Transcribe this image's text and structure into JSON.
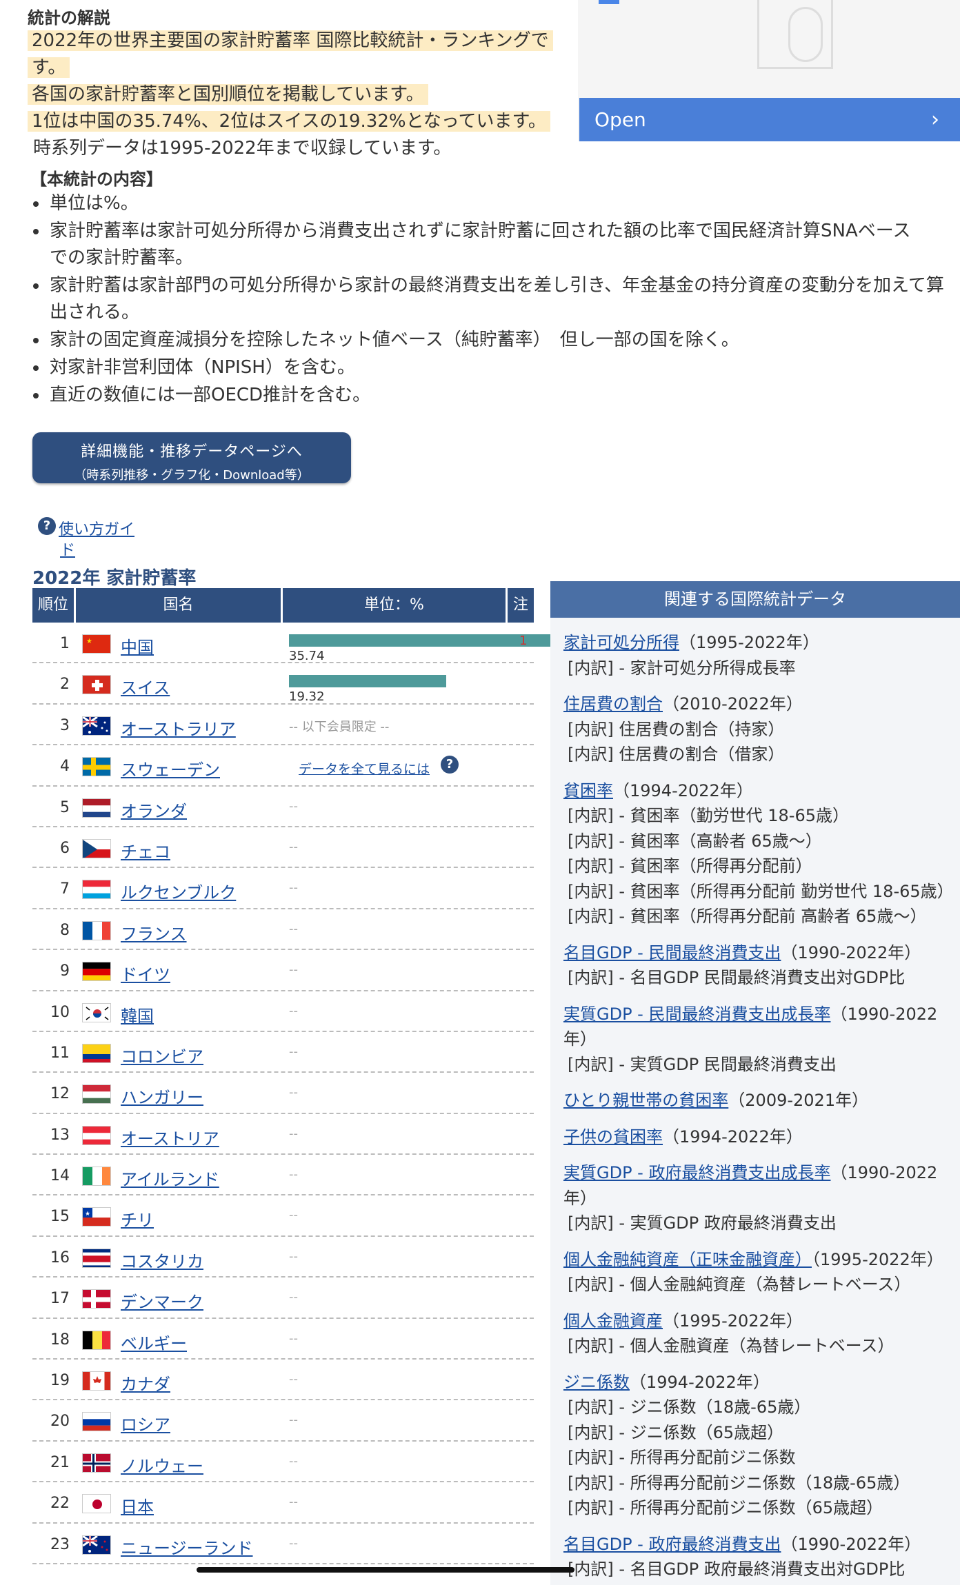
{
  "section_title": "統計の解説",
  "description": {
    "highlight_lines": [
      "2022年の世界主要国の家計貯蓄率 国際比較統計・ランキングで",
      "す。",
      "各国の家計貯蓄率と国別順位を掲載しています。",
      "1位は中国の35.74%、2位はスイスの19.32%となっています。"
    ],
    "plain_line": "時系列データは1995-2022年まで収録しています。"
  },
  "content_heading": "【本統計の内容】",
  "bullets": [
    "単位は%。",
    "家計貯蓄率は家計可処分所得から消費支出されずに家計貯蓄に回された額の比率で国民経済計算SNAベースでの家計貯蓄率。",
    "家計貯蓄は家計部門の可処分所得から家計の最終消費支出を差し引き、年金基金の持分資産の変動分を加えて算出される。",
    "家計の固定資産減損分を控除したネット値ベース（純貯蓄率）　但し一部の国を除く。",
    "対家計非営利団体（NPISH）を含む。",
    "直近の数値には一部OECD推計を含む。"
  ],
  "detail_button": {
    "line1": "詳細機能・推移データページへ",
    "line2": "（時系列推移・グラフ化・Download等）"
  },
  "ad": {
    "open_label": "Open",
    "chevron": "›"
  },
  "guide": {
    "line1": "使い方ガイ",
    "line2": "ド",
    "icon": "?"
  },
  "table": {
    "title": "2022年 家計貯蓄率",
    "headers": {
      "rank": "順位",
      "country": "国名",
      "unit": "単位：%",
      "note": "注"
    },
    "members_only": "-- 以下会員限定 --",
    "see_all": "データを全て見るには",
    "dash": "--",
    "rows": [
      {
        "rank": "1",
        "name": "中国",
        "value": "35.74",
        "bar_fraction": 1.0,
        "note": "1",
        "flag": "cn"
      },
      {
        "rank": "2",
        "name": "スイス",
        "value": "19.32",
        "bar_fraction": 0.5406,
        "flag": "ch"
      },
      {
        "rank": "3",
        "name": "オーストラリア",
        "flag": "au"
      },
      {
        "rank": "4",
        "name": "スウェーデン",
        "flag": "se"
      },
      {
        "rank": "5",
        "name": "オランダ",
        "flag": "nl"
      },
      {
        "rank": "6",
        "name": "チェコ",
        "flag": "cz"
      },
      {
        "rank": "7",
        "name": "ルクセンブルク",
        "flag": "lu"
      },
      {
        "rank": "8",
        "name": "フランス",
        "flag": "fr"
      },
      {
        "rank": "9",
        "name": "ドイツ",
        "flag": "de"
      },
      {
        "rank": "10",
        "name": "韓国",
        "flag": "kr"
      },
      {
        "rank": "11",
        "name": "コロンビア",
        "flag": "co"
      },
      {
        "rank": "12",
        "name": "ハンガリー",
        "flag": "hu"
      },
      {
        "rank": "13",
        "name": "オーストリア",
        "flag": "at"
      },
      {
        "rank": "14",
        "name": "アイルランド",
        "flag": "ie"
      },
      {
        "rank": "15",
        "name": "チリ",
        "flag": "cl"
      },
      {
        "rank": "16",
        "name": "コスタリカ",
        "flag": "cr"
      },
      {
        "rank": "17",
        "name": "デンマーク",
        "flag": "dk"
      },
      {
        "rank": "18",
        "name": "ベルギー",
        "flag": "be"
      },
      {
        "rank": "19",
        "name": "カナダ",
        "flag": "ca"
      },
      {
        "rank": "20",
        "name": "ロシア",
        "flag": "ru"
      },
      {
        "rank": "21",
        "name": "ノルウェー",
        "flag": "no"
      },
      {
        "rank": "22",
        "name": "日本",
        "flag": "jp"
      },
      {
        "rank": "23",
        "name": "ニュージーランド",
        "flag": "nz"
      }
    ]
  },
  "sidebar": {
    "title": "関連する国際統計データ",
    "items": [
      {
        "link": "家計可処分所得",
        "period": "（1995-2022年）",
        "subs": [
          "[内訳] - 家計可処分所得成長率"
        ]
      },
      {
        "link": "住居費の割合",
        "period": "（2010-2022年）",
        "subs": [
          "[内訳] 住居費の割合（持家）",
          "[内訳] 住居費の割合（借家）"
        ]
      },
      {
        "link": "貧困率",
        "period": "（1994-2022年）",
        "subs": [
          "[内訳] - 貧困率（勤労世代 18-65歳）",
          "[内訳] - 貧困率（高齢者 65歳～）",
          "[内訳] - 貧困率（所得再分配前）",
          "[内訳] - 貧困率（所得再分配前 勤労世代 18-65歳）",
          "[内訳] - 貧困率（所得再分配前 高齢者 65歳～）"
        ]
      },
      {
        "link": "名目GDP - 民間最終消費支出",
        "period": "（1990-2022年）",
        "subs": [
          "[内訳] - 名目GDP 民間最終消費支出対GDP比"
        ]
      },
      {
        "link": "実質GDP - 民間最終消費支出成長率",
        "period": "（1990-2022年）",
        "subs": [
          "[内訳] - 実質GDP 民間最終消費支出"
        ]
      },
      {
        "link": "ひとり親世帯の貧困率",
        "period": "（2009-2021年）",
        "subs": []
      },
      {
        "link": "子供の貧困率",
        "period": "（1994-2022年）",
        "subs": []
      },
      {
        "link": "実質GDP - 政府最終消費支出成長率",
        "period": "（1990-2022年）",
        "subs": [
          "[内訳] - 実質GDP 政府最終消費支出"
        ]
      },
      {
        "link": "個人金融純資産（正味金融資産）",
        "period": "（1995-2022年）",
        "subs": [
          "[内訳] - 個人金融純資産（為替レートベース）"
        ]
      },
      {
        "link": "個人金融資産",
        "period": "（1995-2022年）",
        "subs": [
          "[内訳] - 個人金融資産（為替レートベース）"
        ]
      },
      {
        "link": "ジニ係数",
        "period": "（1994-2022年）",
        "subs": [
          "[内訳] - ジニ係数（18歳-65歳）",
          "[内訳] - ジニ係数（65歳超）",
          "[内訳] - 所得再分配前ジニ係数",
          "[内訳] - 所得再分配前ジニ係数（18歳-65歳）",
          "[内訳] - 所得再分配前ジニ係数（65歳超）"
        ]
      },
      {
        "link": "名目GDP - 政府最終消費支出",
        "period": "（1990-2022年）",
        "subs": [
          "[内訳] - 名目GDP 政府最終消費支出対GDP比"
        ]
      }
    ]
  }
}
